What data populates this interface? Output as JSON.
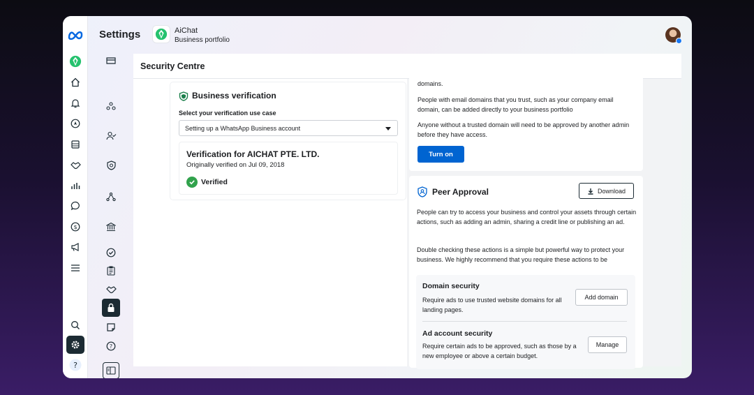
{
  "topbar": {
    "title": "Settings",
    "business_name": "AiChat",
    "business_subtitle": "Business portfolio"
  },
  "rail": {
    "icons": [
      "meta-logo-icon",
      "aichat-logo-icon",
      "home-icon",
      "bell-icon",
      "compass-icon",
      "pages-icon",
      "handshake-icon",
      "bar-chart-icon",
      "chat-bubble-icon",
      "dollar-icon",
      "megaphone-icon",
      "menu-icon",
      "search-icon",
      "gear-icon",
      "help-icon"
    ]
  },
  "subnav": {
    "icons": [
      "inbox-icon",
      "people-network-icon",
      "person-check-icon",
      "shield-icon",
      "nodes-icon",
      "bank-icon",
      "check-circle-icon",
      "clipboard-icon",
      "handshake-icon",
      "lock-icon",
      "note-icon",
      "help-circle-icon",
      "panel-icon"
    ]
  },
  "content": {
    "title": "Security Centre"
  },
  "business_verification": {
    "title": "Business verification",
    "select_label": "Select your verification use case",
    "select_value": "Setting up a WhatsApp Business account",
    "verification_title": "Verification for AICHAT PTE. LTD.",
    "verified_date": "Originally verified on Jul 09, 2018",
    "status": "Verified",
    "status_color": "#31a24c"
  },
  "trusted_domains": {
    "para0": "domains.",
    "para1": "People with email domains that you trust, such as your company email domain, can be added directly to your business portfolio",
    "para2": "Anyone without a trusted domain will need to be approved by another admin before they have access.",
    "button": "Turn on"
  },
  "peer_approval": {
    "title": "Peer Approval",
    "download_button": "Download",
    "para1": "People can try to access your business and control your assets through certain actions, such as adding an admin, sharing a credit line or publishing an ad.",
    "para2": "Double checking these actions is a simple but powerful way to protect your business. We highly recommend that you require these actions to be",
    "domain_security": {
      "title": "Domain security",
      "description": "Require ads to use trusted website domains for all landing pages.",
      "button": "Add domain"
    },
    "ad_account_security": {
      "title": "Ad account security",
      "description": "Require certain ads to be approved, such as those by a new employee or above a certain budget.",
      "button": "Manage"
    }
  },
  "colors": {
    "primary_button": "#0064d1",
    "active_icon_bg": "#1c2b33",
    "meta_blue": "#0668e1",
    "aichat_green": "#25c26e"
  }
}
